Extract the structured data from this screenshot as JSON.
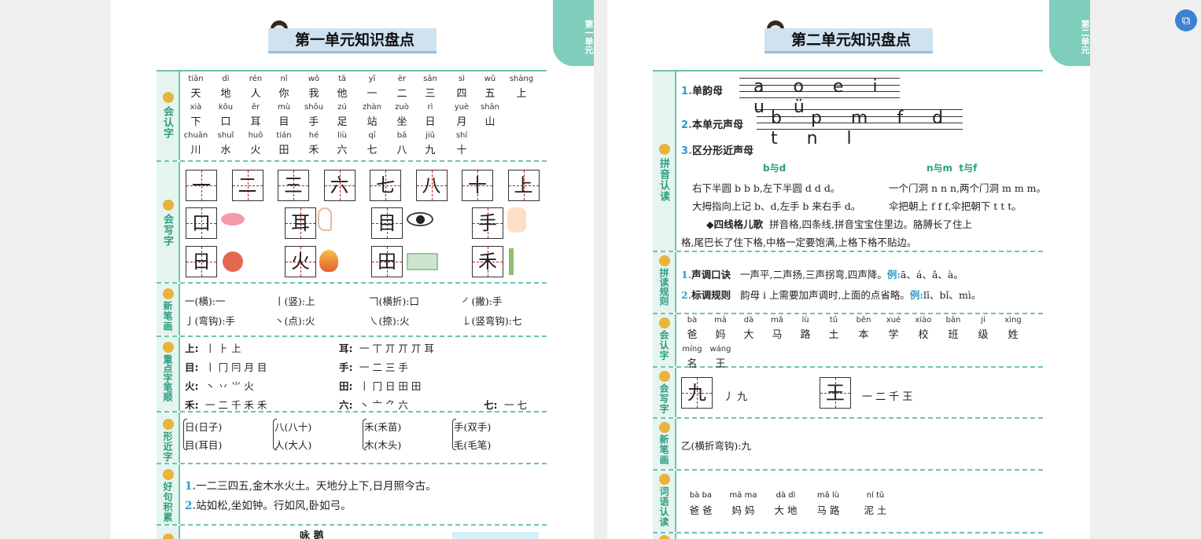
{
  "page1": {
    "tab": "第一单元",
    "title": "第一单元知识盘点",
    "sections": {
      "recognize_label": "会认字",
      "write_label": "会写字",
      "strokes_label": "新笔画",
      "order_label": "重点字笔顺",
      "similar_label": "形近字",
      "sentences_label": "好句积累"
    },
    "recognize": [
      [
        [
          "tiān",
          "天"
        ],
        [
          "dì",
          "地"
        ],
        [
          "rén",
          "人"
        ],
        [
          "nǐ",
          "你"
        ],
        [
          "wǒ",
          "我"
        ],
        [
          "tā",
          "他"
        ],
        [
          "yī",
          "一"
        ],
        [
          "èr",
          "二"
        ],
        [
          "sān",
          "三"
        ],
        [
          "sì",
          "四"
        ],
        [
          "wǔ",
          "五"
        ],
        [
          "shàng",
          "上"
        ]
      ],
      [
        [
          "xià",
          "下"
        ],
        [
          "kǒu",
          "口"
        ],
        [
          "ěr",
          "耳"
        ],
        [
          "mù",
          "目"
        ],
        [
          "shǒu",
          "手"
        ],
        [
          "zú",
          "足"
        ],
        [
          "zhàn",
          "站"
        ],
        [
          "zuò",
          "坐"
        ],
        [
          "rì",
          "日"
        ],
        [
          "yuè",
          "月"
        ],
        [
          "shān",
          "山"
        ]
      ],
      [
        [
          "chuān",
          "川"
        ],
        [
          "shuǐ",
          "水"
        ],
        [
          "huǒ",
          "火"
        ],
        [
          "tián",
          "田"
        ],
        [
          "hé",
          "禾"
        ],
        [
          "liù",
          "六"
        ],
        [
          "qī",
          "七"
        ],
        [
          "bā",
          "八"
        ],
        [
          "jiǔ",
          "九"
        ],
        [
          "shí",
          "十"
        ]
      ]
    ],
    "write_row1": [
      "一",
      "二",
      "三",
      "六",
      "七",
      "八",
      "十",
      "上"
    ],
    "write_row2": [
      "口",
      "耳",
      "目",
      "手"
    ],
    "write_row3": [
      "日",
      "火",
      "田",
      "禾"
    ],
    "strokes": [
      [
        "一(横):一",
        "丨(竖):上",
        "𠃍(横折):口",
        "㇒(撇):手"
      ],
      [
        "亅(弯钩):手",
        "丶(点):火",
        "㇏(捺):火",
        "𠄌(竖弯钩):七"
      ]
    ],
    "order": [
      [
        "上:",
        "丨  ⺊  上",
        "耳:",
        "一  丅  丌  丌  丌  耳"
      ],
      [
        "目:",
        "丨  冂  冃  月  目",
        "手:",
        "一  二  三  手"
      ],
      [
        "火:",
        "丶  丷  ⺌  火",
        "田:",
        "丨  冂  日  田  田"
      ],
      [
        "禾:",
        "一  二  千  禾  禾",
        "六:",
        "丶  亠  ⺈  六",
        "七:",
        "一  七"
      ]
    ],
    "similar": [
      [
        "日(日子)",
        "八(八十)",
        "禾(禾苗)",
        "手(双手)"
      ],
      [
        "目(耳目)",
        "人(大人)",
        "木(木头)",
        "毛(毛笔)"
      ]
    ],
    "sentences": [
      "一二三四五,金木水火土。天地分上下,日月照今古。",
      "站如松,坐如钟。行如风,卧如弓。"
    ],
    "poem_title": "咏  鹅"
  },
  "page2": {
    "tab": "第二单元",
    "title": "第二单元知识盘点",
    "sections": {
      "pinyin_label": "拼音认读",
      "rules_label": "拼读规则",
      "recognize_label": "会认字",
      "write_label": "会写字",
      "strokes_label": "新笔画",
      "words_label": "词语认读"
    },
    "vowels_label": "单韵母",
    "vowels": "a o e i u ü",
    "initials_label": "本单元声母",
    "initials": "b p m f d t n l",
    "similar_label": "区分形近声母",
    "pair1": "b与d",
    "pair2": "n与m  t与f",
    "rhymes": [
      "右下半圆 b b b,左下半圆 d d d。",
      "一个门洞 n n n,两个门洞 m m m。",
      "大拇指向上记 b、d,左手 b 来右手 d。",
      "伞把朝上 f f f,伞把朝下 t t t。"
    ],
    "song_title": "◆四线格儿歌",
    "song": [
      "拼音格,四条线,拼音宝宝住里边。胳膊长了住上",
      "格,尾巴长了住下格,中格一定要饱满,上格下格不贴边。"
    ],
    "rule1_label": "声调口诀",
    "rule1": "一声平,二声扬,三声拐弯,四声降。",
    "rule1_ex_label": "例:",
    "rule1_ex": "ā、á、ǎ、à。",
    "rule2_label": "标调规则",
    "rule2": "韵母 i 上需要加声调时,上面的点省略。",
    "rule2_ex_label": "例:",
    "rule2_ex": "lī、bǐ、mì。",
    "recognize": [
      [
        [
          "bà",
          "爸"
        ],
        [
          "mā",
          "妈"
        ],
        [
          "dà",
          "大"
        ],
        [
          "mǎ",
          "马"
        ],
        [
          "lù",
          "路"
        ],
        [
          "tǔ",
          "土"
        ],
        [
          "běn",
          "本"
        ],
        [
          "xué",
          "学"
        ],
        [
          "xiào",
          "校"
        ],
        [
          "bān",
          "班"
        ],
        [
          "jí",
          "级"
        ],
        [
          "xìng",
          "姓"
        ]
      ],
      [
        [
          "míng",
          "名"
        ],
        [
          "wáng",
          "王"
        ]
      ]
    ],
    "write": [
      [
        "九",
        "丿  九"
      ],
      [
        "王",
        "一  二  千  王"
      ]
    ],
    "new_stroke": "乙(横折弯钩):九",
    "words": [
      [
        "bà ba",
        "爸 爸"
      ],
      [
        "mā ma",
        "妈 妈"
      ],
      [
        "dà dì",
        "大 地"
      ],
      [
        "mǎ lù",
        "马 路"
      ],
      [
        "ní tǔ",
        "泥 土"
      ]
    ]
  },
  "toolbar": {
    "float_icon": "⧉"
  }
}
